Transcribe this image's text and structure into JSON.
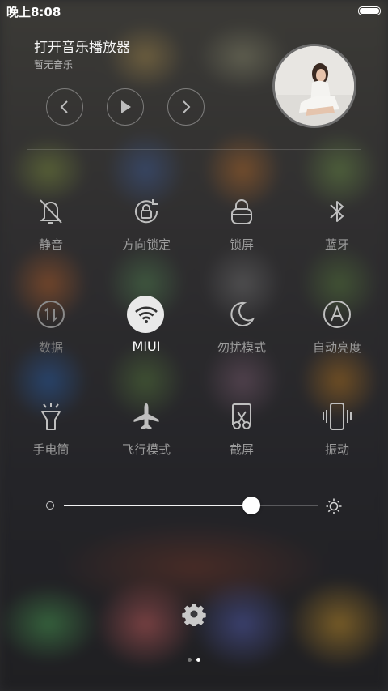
{
  "status_bar": {
    "time": "晚上8:08",
    "battery_icon": "battery-icon"
  },
  "music": {
    "title": "打开音乐播放器",
    "subtitle": "暂无音乐",
    "controls": [
      "previous-icon",
      "play-icon",
      "next-icon"
    ],
    "album_art": "album-art-photo"
  },
  "toggles": [
    {
      "label": "静音",
      "icon": "bell-off-icon",
      "state": "off"
    },
    {
      "label": "方向锁定",
      "icon": "rotation-lock-icon",
      "state": "off"
    },
    {
      "label": "锁屏",
      "icon": "lock-icon",
      "state": "off"
    },
    {
      "label": "蓝牙",
      "icon": "bluetooth-icon",
      "state": "off"
    },
    {
      "label": "数据",
      "icon": "mobile-data-icon",
      "state": "disabled"
    },
    {
      "label": "MIUI",
      "icon": "wifi-icon",
      "state": "on"
    },
    {
      "label": "勿扰模式",
      "icon": "moon-icon",
      "state": "off"
    },
    {
      "label": "自动亮度",
      "icon": "auto-brightness-icon",
      "state": "off"
    },
    {
      "label": "手电筒",
      "icon": "flashlight-icon",
      "state": "off"
    },
    {
      "label": "飞行模式",
      "icon": "airplane-icon",
      "state": "off"
    },
    {
      "label": "截屏",
      "icon": "screenshot-icon",
      "state": "off"
    },
    {
      "label": "振动",
      "icon": "vibrate-icon",
      "state": "off"
    }
  ],
  "brightness": {
    "level": 0.74,
    "low_icon": "brightness-low-icon",
    "high_icon": "sun-icon"
  },
  "settings": {
    "icon": "gear-icon"
  },
  "pager": {
    "pages": 2,
    "active": 1
  },
  "colors": {
    "active_toggle_bg": "#e9e9e9",
    "label_inactive": "#9c9c9c",
    "label_active": "#ffffff"
  }
}
